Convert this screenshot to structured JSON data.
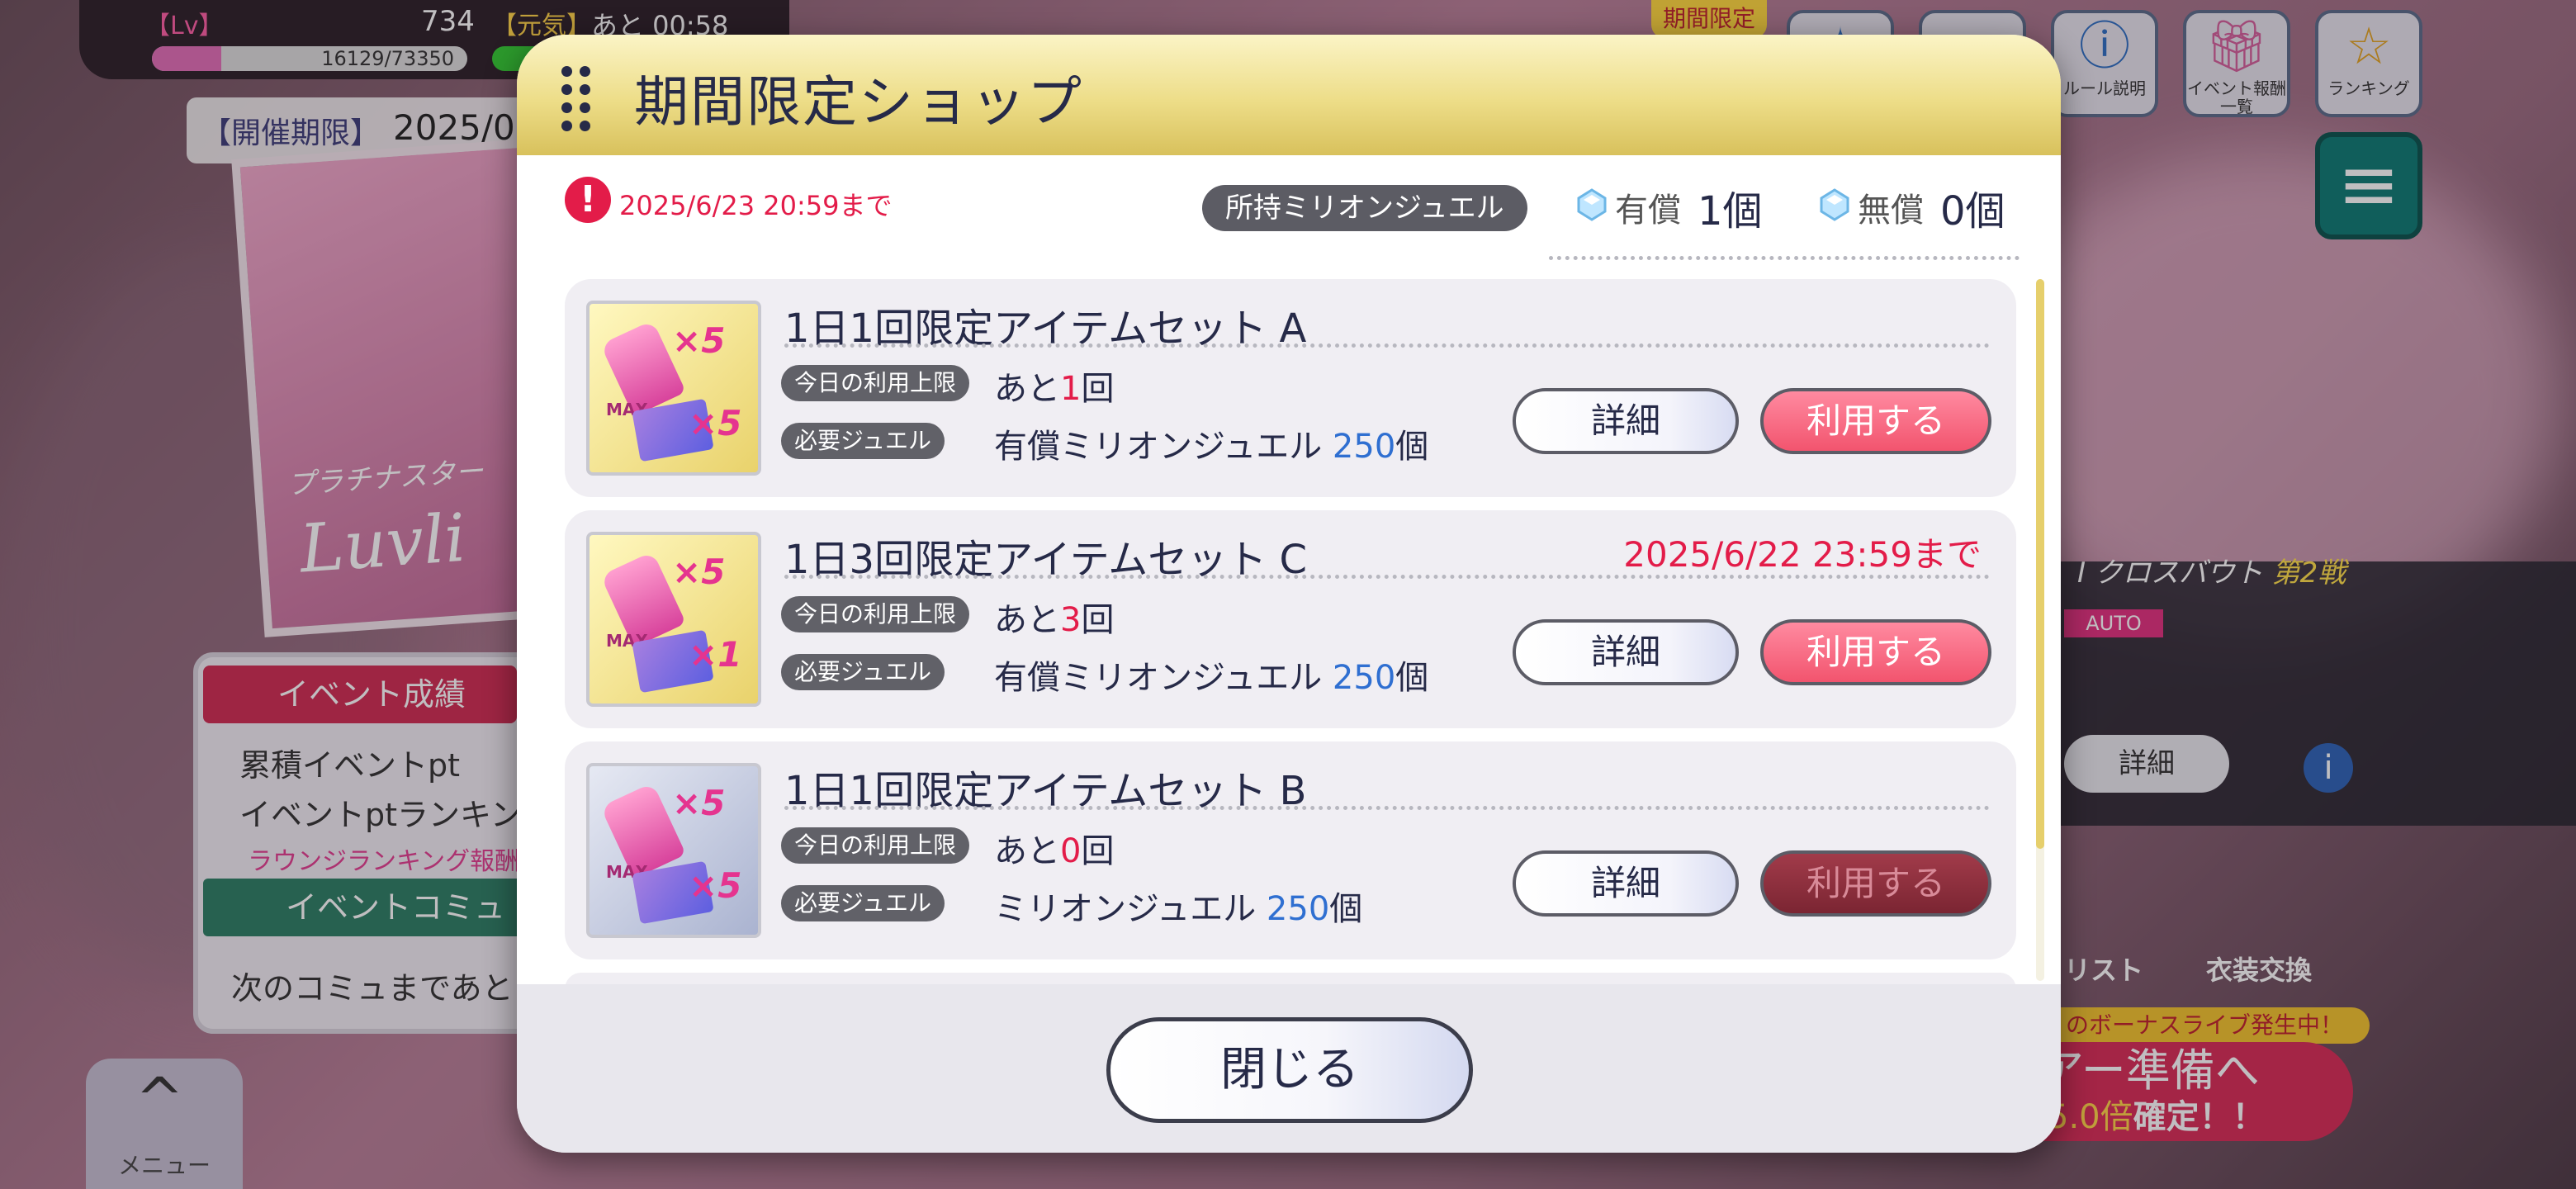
{
  "background": {
    "status": {
      "lv_label": "【Lv】",
      "lv_value": "734",
      "genki_label": "【元気】",
      "remaining": "あと 00:58",
      "exp_text": "16129/73350",
      "exp_progress": 0.22
    },
    "period_label": "【開催期限】",
    "period_value": "2025/0",
    "poster_subtitle": "プラチナスター",
    "poster_title": "Luvli",
    "event_panel": {
      "header": "イベント成績",
      "line1": "累積イベントpt",
      "line2": "イベントptランキン",
      "pink": "ラウンジランキング報酬",
      "green": "イベントコミュ",
      "next": "次のコミュまであと"
    },
    "menu_label": "メニュー",
    "top_right": {
      "limited_tag": "期間限定",
      "rules_label": "ルール説明",
      "rewards_label": "イベント報酬一覧",
      "ranking_label": "ランキング"
    },
    "live": {
      "title": "I クロスバウト",
      "round": "第2戦",
      "auto": "AUTO",
      "detail": "詳細",
      "list_label": "リスト",
      "costume_label": "衣装交換",
      "bonus": "のボーナスライブ発生中！",
      "tour": "アー準備へ",
      "multiplier": "5.0倍",
      "confirm": "確定！！"
    }
  },
  "modal": {
    "title": "期間限定ショップ",
    "deadline": "2025/6/23 20:59まで",
    "owned_label": "所持ミリオンジュエル",
    "paid_label": "有償",
    "paid_count": "1個",
    "free_label": "無償",
    "free_count": "0個",
    "items": [
      {
        "title": "1日1回限定アイテムセット A",
        "deadline": "",
        "limit_label": "今日の利用上限",
        "remaining_prefix": "あと",
        "remaining": "1",
        "remaining_suffix": "回",
        "jewel_label": "必要ジュエル",
        "jewel_type": "有償ミリオンジュエル",
        "cost": "250",
        "cost_unit": "個",
        "detail": "詳細",
        "use": "利用する",
        "mult1": "×5",
        "mult2": "×5",
        "max": "MAX"
      },
      {
        "title": "1日3回限定アイテムセット C",
        "deadline": "2025/6/22 23:59まで",
        "limit_label": "今日の利用上限",
        "remaining_prefix": "あと",
        "remaining": "3",
        "remaining_suffix": "回",
        "jewel_label": "必要ジュエル",
        "jewel_type": "有償ミリオンジュエル",
        "cost": "250",
        "cost_unit": "個",
        "detail": "詳細",
        "use": "利用する",
        "mult1": "×5",
        "mult2": "×1",
        "max": "MAX"
      },
      {
        "title": "1日1回限定アイテムセット B",
        "deadline": "",
        "limit_label": "今日の利用上限",
        "remaining_prefix": "あと",
        "remaining": "0",
        "remaining_suffix": "回",
        "jewel_label": "必要ジュエル",
        "jewel_type": "ミリオンジュエル",
        "cost": "250",
        "cost_unit": "個",
        "detail": "詳細",
        "use": "利用する",
        "mult1": "×5",
        "mult2": "×5",
        "max": "MAX"
      }
    ],
    "close_label": "閉じる"
  },
  "colors": {
    "accent_red": "#e31c49",
    "use_button": "#f2546e",
    "use_button_disabled": "#7b2532",
    "header_gold": "#eddd88",
    "cost_blue": "#2f6fd1"
  },
  "icons": [
    "alert-icon",
    "gem-icon",
    "grip-icon",
    "info-icon",
    "gift-icon",
    "trophy-icon",
    "hamburger-icon",
    "chevron-up-icon"
  ]
}
